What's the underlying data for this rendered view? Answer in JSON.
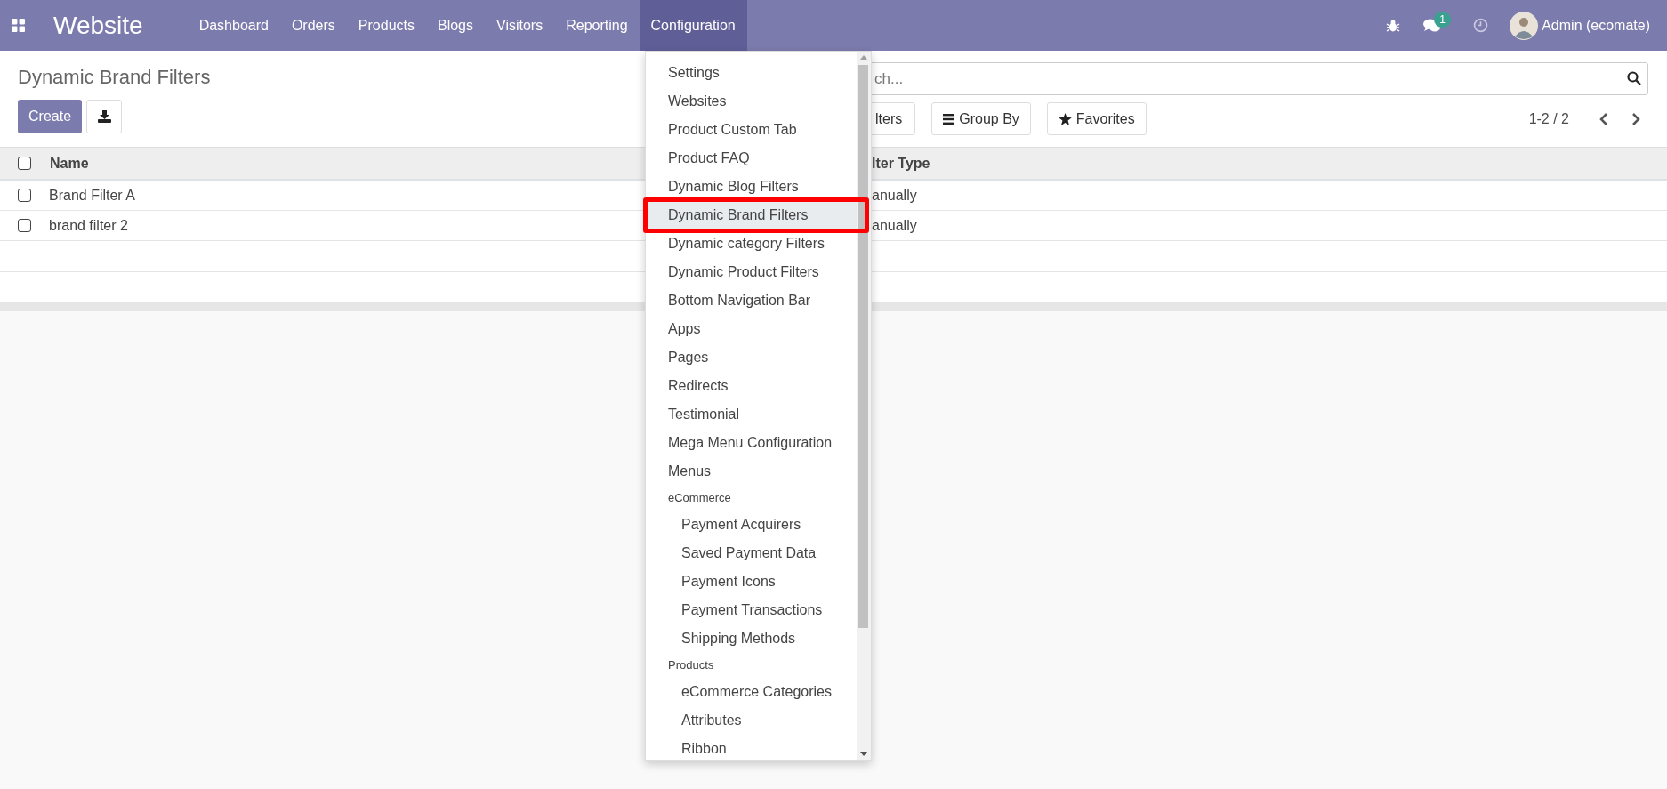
{
  "navbar": {
    "app_title": "Website",
    "menu": [
      {
        "label": "Dashboard",
        "selected": false
      },
      {
        "label": "Orders",
        "selected": false
      },
      {
        "label": "Products",
        "selected": false
      },
      {
        "label": "Blogs",
        "selected": false
      },
      {
        "label": "Visitors",
        "selected": false
      },
      {
        "label": "Reporting",
        "selected": false
      },
      {
        "label": "Configuration",
        "selected": true
      }
    ],
    "message_count": "1",
    "user": "Admin (ecomate)"
  },
  "control_panel": {
    "title": "Dynamic Brand Filters",
    "create_button": "Create",
    "search": {
      "placeholder": "ch..."
    },
    "filter_buttons": [
      {
        "kind": "filters",
        "label": "lters"
      },
      {
        "kind": "groupby",
        "label": "Group By"
      },
      {
        "kind": "favorites",
        "label": "Favorites"
      }
    ],
    "pager": "1-2 / 2"
  },
  "table": {
    "select_all_checked": false,
    "columns": [
      "Name",
      "lter Type"
    ],
    "rows": [
      {
        "checked": false,
        "cells": [
          "Brand Filter A",
          "anually"
        ]
      },
      {
        "checked": false,
        "cells": [
          "brand filter 2",
          "anually"
        ]
      }
    ]
  },
  "dropdown": {
    "items": [
      {
        "kind": "item",
        "label": "Settings",
        "selected": false
      },
      {
        "kind": "item",
        "label": "Websites",
        "selected": false
      },
      {
        "kind": "item",
        "label": "Product Custom Tab",
        "selected": false
      },
      {
        "kind": "item",
        "label": "Product FAQ",
        "selected": false
      },
      {
        "kind": "item",
        "label": "Dynamic Blog Filters",
        "selected": false
      },
      {
        "kind": "item",
        "label": "Dynamic Brand Filters",
        "selected": true
      },
      {
        "kind": "item",
        "label": "Dynamic category Filters",
        "selected": false
      },
      {
        "kind": "item",
        "label": "Dynamic Product Filters",
        "selected": false
      },
      {
        "kind": "item",
        "label": "Bottom Navigation Bar",
        "selected": false
      },
      {
        "kind": "item",
        "label": "Apps",
        "selected": false
      },
      {
        "kind": "item",
        "label": "Pages",
        "selected": false
      },
      {
        "kind": "item",
        "label": "Redirects",
        "selected": false
      },
      {
        "kind": "item",
        "label": "Testimonial",
        "selected": false
      },
      {
        "kind": "item",
        "label": "Mega Menu Configuration",
        "selected": false
      },
      {
        "kind": "item",
        "label": "Menus",
        "selected": false
      },
      {
        "kind": "section",
        "label": "eCommerce",
        "children": [
          {
            "label": "Payment Acquirers",
            "selected": false
          },
          {
            "label": "Saved Payment Data",
            "selected": false
          },
          {
            "label": "Payment Icons",
            "selected": false
          },
          {
            "label": "Payment Transactions",
            "selected": false
          },
          {
            "label": "Shipping Methods",
            "selected": false
          }
        ]
      },
      {
        "kind": "section",
        "label": "Products",
        "children": [
          {
            "label": "eCommerce Categories",
            "selected": false
          },
          {
            "label": "Attributes",
            "selected": false
          },
          {
            "label": "Ribbon",
            "selected": false
          }
        ]
      }
    ]
  }
}
